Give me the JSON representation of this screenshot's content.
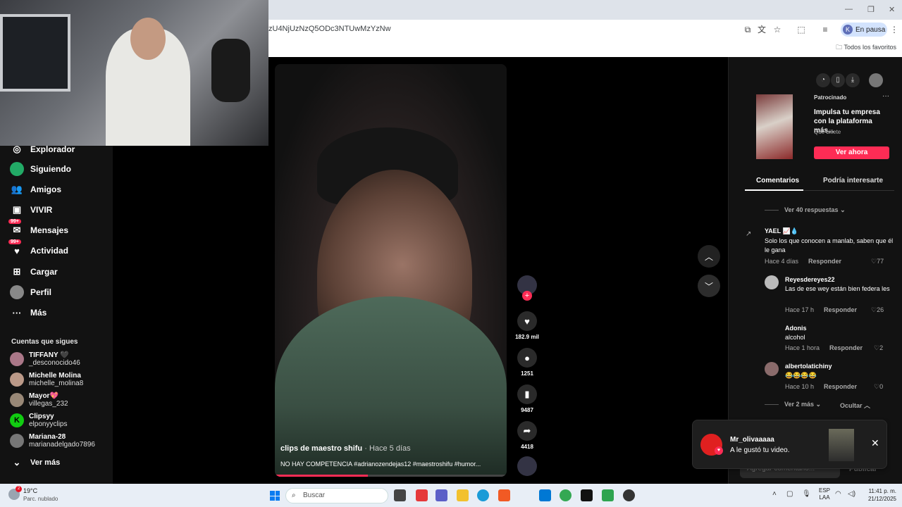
{
  "browser": {
    "url": "zU4NjUzNzQ5ODc3NTUwMzYzNw",
    "profile_initial": "K",
    "profile_status": "En pausa",
    "bookmarks_label": "Todos los favoritos"
  },
  "sidebar": {
    "items": [
      {
        "label": "Explorador",
        "icon": "compass-icon"
      },
      {
        "label": "Siguiendo",
        "icon": "following-icon"
      },
      {
        "label": "Amigos",
        "icon": "friends-icon"
      },
      {
        "label": "VIVIR",
        "icon": "live-icon"
      },
      {
        "label": "Mensajes",
        "icon": "messages-icon",
        "badge": "99+"
      },
      {
        "label": "Actividad",
        "icon": "activity-icon",
        "badge": "99+"
      },
      {
        "label": "Cargar",
        "icon": "upload-icon"
      },
      {
        "label": "Perfil",
        "icon": "profile-icon"
      },
      {
        "label": "Más",
        "icon": "more-icon"
      }
    ],
    "following_title": "Cuentas que sigues",
    "following": [
      {
        "name": "TIFFANY 🖤",
        "handle": "_desconocido46"
      },
      {
        "name": "Michelle Molina",
        "handle": "michelle_molina8"
      },
      {
        "name": "Mayor💖",
        "handle": "villegas_232"
      },
      {
        "name": "Clipsyy",
        "handle": "elponyyclips"
      },
      {
        "name": "Mariana-28",
        "handle": "marianadelgado7896"
      }
    ],
    "see_more": "Ver más"
  },
  "video": {
    "author": "clips de maestro shifu",
    "age": "· Hace 5 días",
    "description": "NO HAY COMPETENCIA #adrianozendejas12 #maestroshifu #humor...",
    "progress": 0.4
  },
  "actions": {
    "likes": "182.9 mil",
    "comments": "1251",
    "saves": "9487",
    "shares": "4418"
  },
  "ad": {
    "sponsored": "Patrocinado",
    "title": "Impulsa tu empresa con la plataforma más...",
    "brand": "Qué billete",
    "cta": "Ver ahora"
  },
  "tabs": {
    "comments": "Comentarios",
    "interesting": "Podría interesarte"
  },
  "comments": {
    "view_replies": "Ver 40 respuestas",
    "list": [
      {
        "name": "YAEL 📈💧",
        "text": "Solo los que conocen a manlab, saben que él le gana",
        "time": "Hace 4 días",
        "reply": "Responder",
        "likes": "77"
      },
      {
        "name": "Reyesdereyes22",
        "text": "Las de ese wey están bien federa les",
        "time": "Hace 17 h",
        "reply": "Responder",
        "likes": "26"
      },
      {
        "name": "Adonis",
        "text": "alcohol",
        "time": "Hace 1 hora",
        "reply": "Responder",
        "likes": "2"
      },
      {
        "name": "albertolatichiny",
        "text": "😂😂😂😂",
        "time": "Hace 10 h",
        "reply": "Responder",
        "likes": "0"
      }
    ],
    "view_more": "Ver 2 más",
    "hide": "Ocultar",
    "add_placeholder": "Agregar comentario...",
    "publish": "Publicar"
  },
  "notification": {
    "user": "Mr_olivaaaaa",
    "message": "A le gustó tu video."
  },
  "taskbar": {
    "temp": "19°C",
    "weather": "Parc. nublado",
    "weather_badge": "2",
    "search_placeholder": "Buscar",
    "lang1": "ESP",
    "lang2": "LAA",
    "time": "11:41 p. m.",
    "date": "21/12/2025"
  }
}
